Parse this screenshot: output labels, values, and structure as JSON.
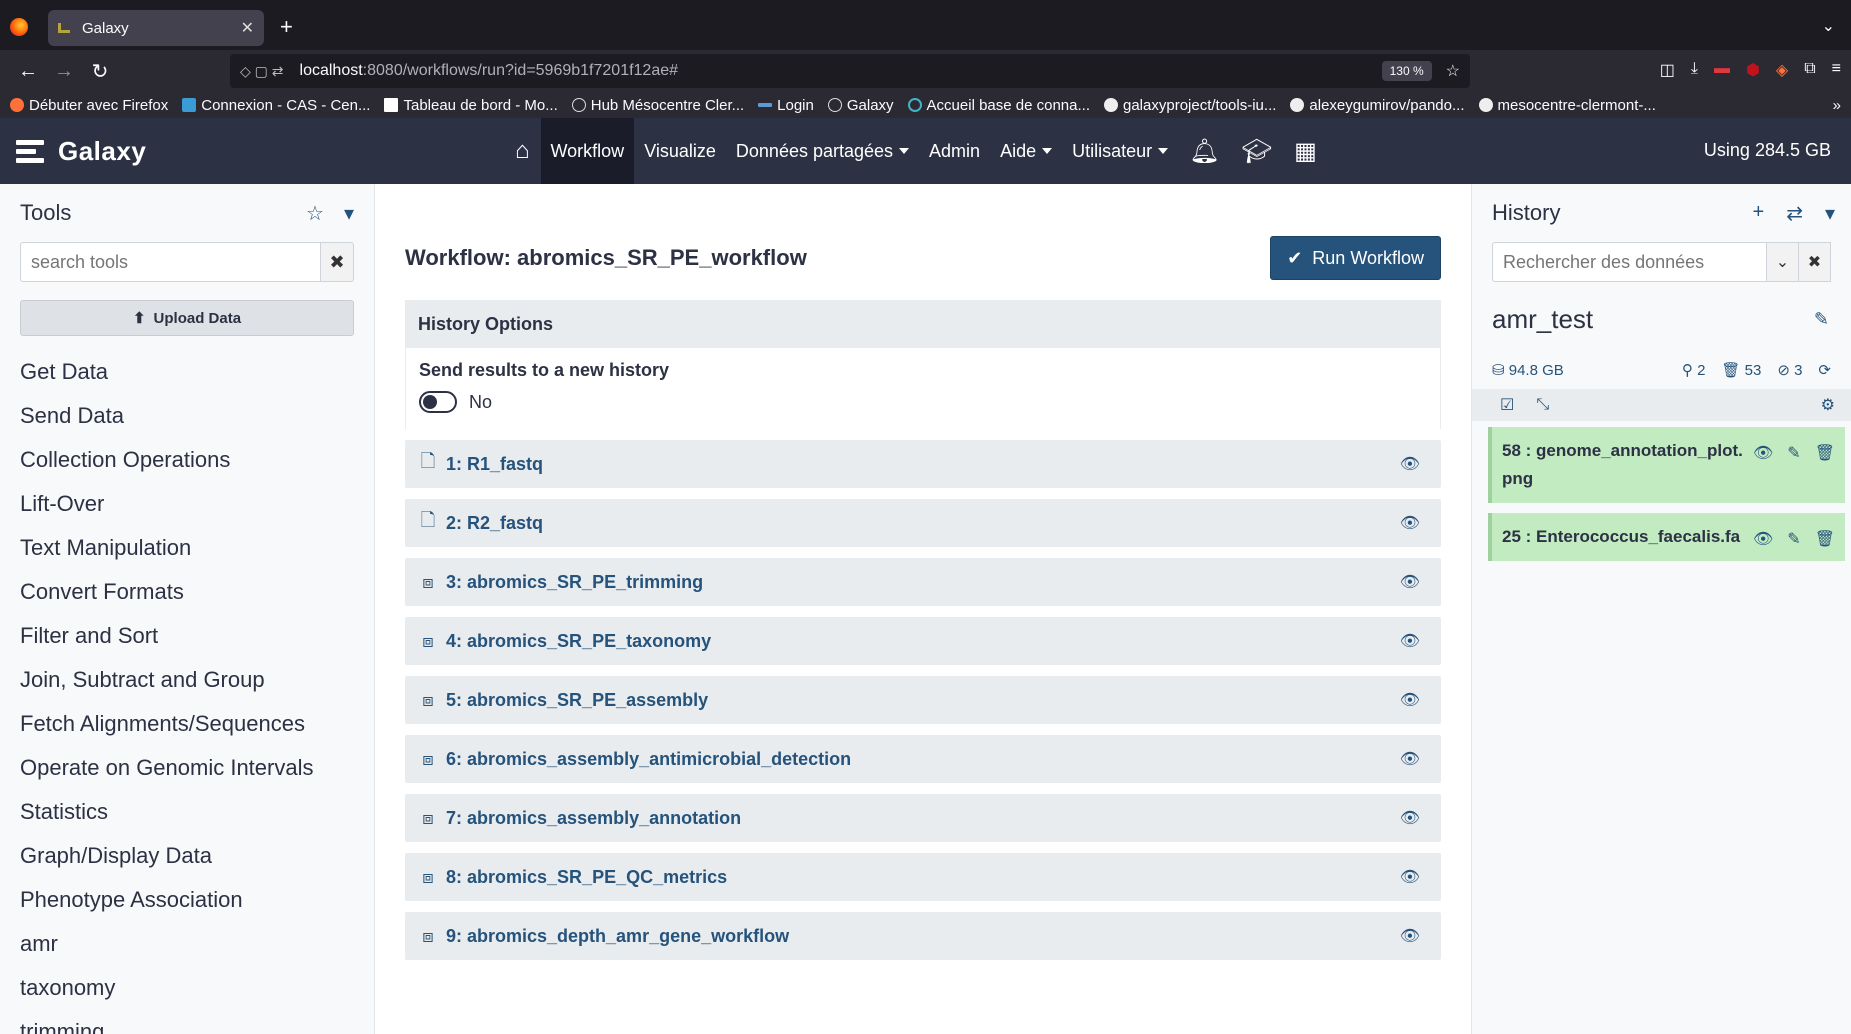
{
  "browser": {
    "tab_title": "Galaxy",
    "url_host": "localhost",
    "url_rest": ":8080/workflows/run?id=5969b1f7201f12ae#",
    "zoom": "130 %",
    "bookmarks": [
      "Débuter avec Firefox",
      "Connexion - CAS - Cen...",
      "Tableau de bord - Mo...",
      "Hub Mésocentre Cler...",
      "Login",
      "Galaxy",
      "Accueil base de conna...",
      "galaxyproject/tools-iu...",
      "alexeygumirov/pando...",
      "mesocentre-clermont-..."
    ]
  },
  "masthead": {
    "brand": "Galaxy",
    "nav": {
      "workflow": "Workflow",
      "visualize": "Visualize",
      "shared": "Données partagées",
      "admin": "Admin",
      "help": "Aide",
      "user": "Utilisateur"
    },
    "usage": "Using 284.5 GB"
  },
  "tools": {
    "title": "Tools",
    "search_placeholder": "search tools",
    "upload_label": "Upload Data",
    "sections": [
      "Get Data",
      "Send Data",
      "Collection Operations",
      "Lift-Over",
      "Text Manipulation",
      "Convert Formats",
      "Filter and Sort",
      "Join, Subtract and Group",
      "Fetch Alignments/Sequences",
      "Operate on Genomic Intervals",
      "Statistics",
      "Graph/Display Data",
      "Phenotype Association",
      "amr",
      "taxonomy",
      "trimming"
    ]
  },
  "workflow": {
    "title": "Workflow: abromics_SR_PE_workflow",
    "run_label": "Run Workflow",
    "history_options_title": "History Options",
    "send_results_label": "Send results to a new history",
    "send_results_value": "No",
    "steps": [
      {
        "label": "1: R1_fastq",
        "type": "file"
      },
      {
        "label": "2: R2_fastq",
        "type": "file"
      },
      {
        "label": "3: abromics_SR_PE_trimming",
        "type": "subworkflow"
      },
      {
        "label": "4: abromics_SR_PE_taxonomy",
        "type": "subworkflow"
      },
      {
        "label": "5: abromics_SR_PE_assembly",
        "type": "subworkflow"
      },
      {
        "label": "6: abromics_assembly_antimicrobial_detection",
        "type": "subworkflow"
      },
      {
        "label": "7: abromics_assembly_annotation",
        "type": "subworkflow"
      },
      {
        "label": "8: abromics_SR_PE_QC_metrics",
        "type": "subworkflow"
      },
      {
        "label": "9: abromics_depth_amr_gene_workflow",
        "type": "subworkflow"
      }
    ]
  },
  "history": {
    "title": "History",
    "search_placeholder": "Rechercher des données",
    "name": "amr_test",
    "size": "94.8 GB",
    "shown_count": "2",
    "deleted_count": "53",
    "hidden_count": "3",
    "datasets": [
      {
        "label": "58 : genome_annotation_plot.png"
      },
      {
        "label": "25 : Enterococcus_faecalis.fa"
      }
    ]
  },
  "colors": {
    "masthead": "#2c3143",
    "accent": "#25537b",
    "dataset_ok": "#c2ebc2"
  }
}
